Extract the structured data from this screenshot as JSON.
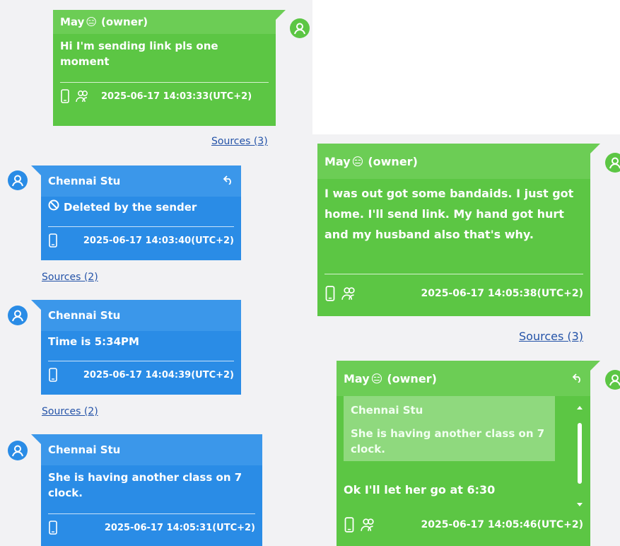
{
  "messages": [
    {
      "sender": "May",
      "emoji": "😑",
      "role": "(owner)",
      "text": "Hi I'm sending link pls one moment",
      "timestamp": "2025-06-17 14:03:33(UTC+2)",
      "sources": "Sources (3)"
    },
    {
      "sender": "Chennai Stu",
      "text": "Deleted by the sender",
      "timestamp": "2025-06-17 14:03:40(UTC+2)",
      "sources": "Sources (2)"
    },
    {
      "sender": "Chennai Stu",
      "text": "Time is 5:34PM",
      "timestamp": "2025-06-17 14:04:39(UTC+2)",
      "sources": "Sources (2)"
    },
    {
      "sender": "Chennai Stu",
      "text": "She is having another class on 7 clock.",
      "timestamp": "2025-06-17 14:05:31(UTC+2)"
    },
    {
      "sender": "May",
      "emoji": "😑",
      "role": "(owner)",
      "text": "I was out got some bandaids. I just got home. I'll send link. My hand got hurt and my husband also that's why.",
      "timestamp": "2025-06-17 14:05:38(UTC+2)",
      "sources": "Sources (3)"
    },
    {
      "sender": "May",
      "emoji": "😑",
      "role": "(owner)",
      "quote_sender": "Chennai Stu",
      "quote_text": "She is having another class on 7 clock.",
      "text": "Ok I'll let her go at 6:30",
      "timestamp": "2025-06-17 14:05:46(UTC+2)"
    }
  ],
  "colors": {
    "owner_bubble": "#5cc644",
    "other_bubble": "#2a8ce6",
    "link": "#2453a8",
    "panel": "#f2f2f4"
  }
}
